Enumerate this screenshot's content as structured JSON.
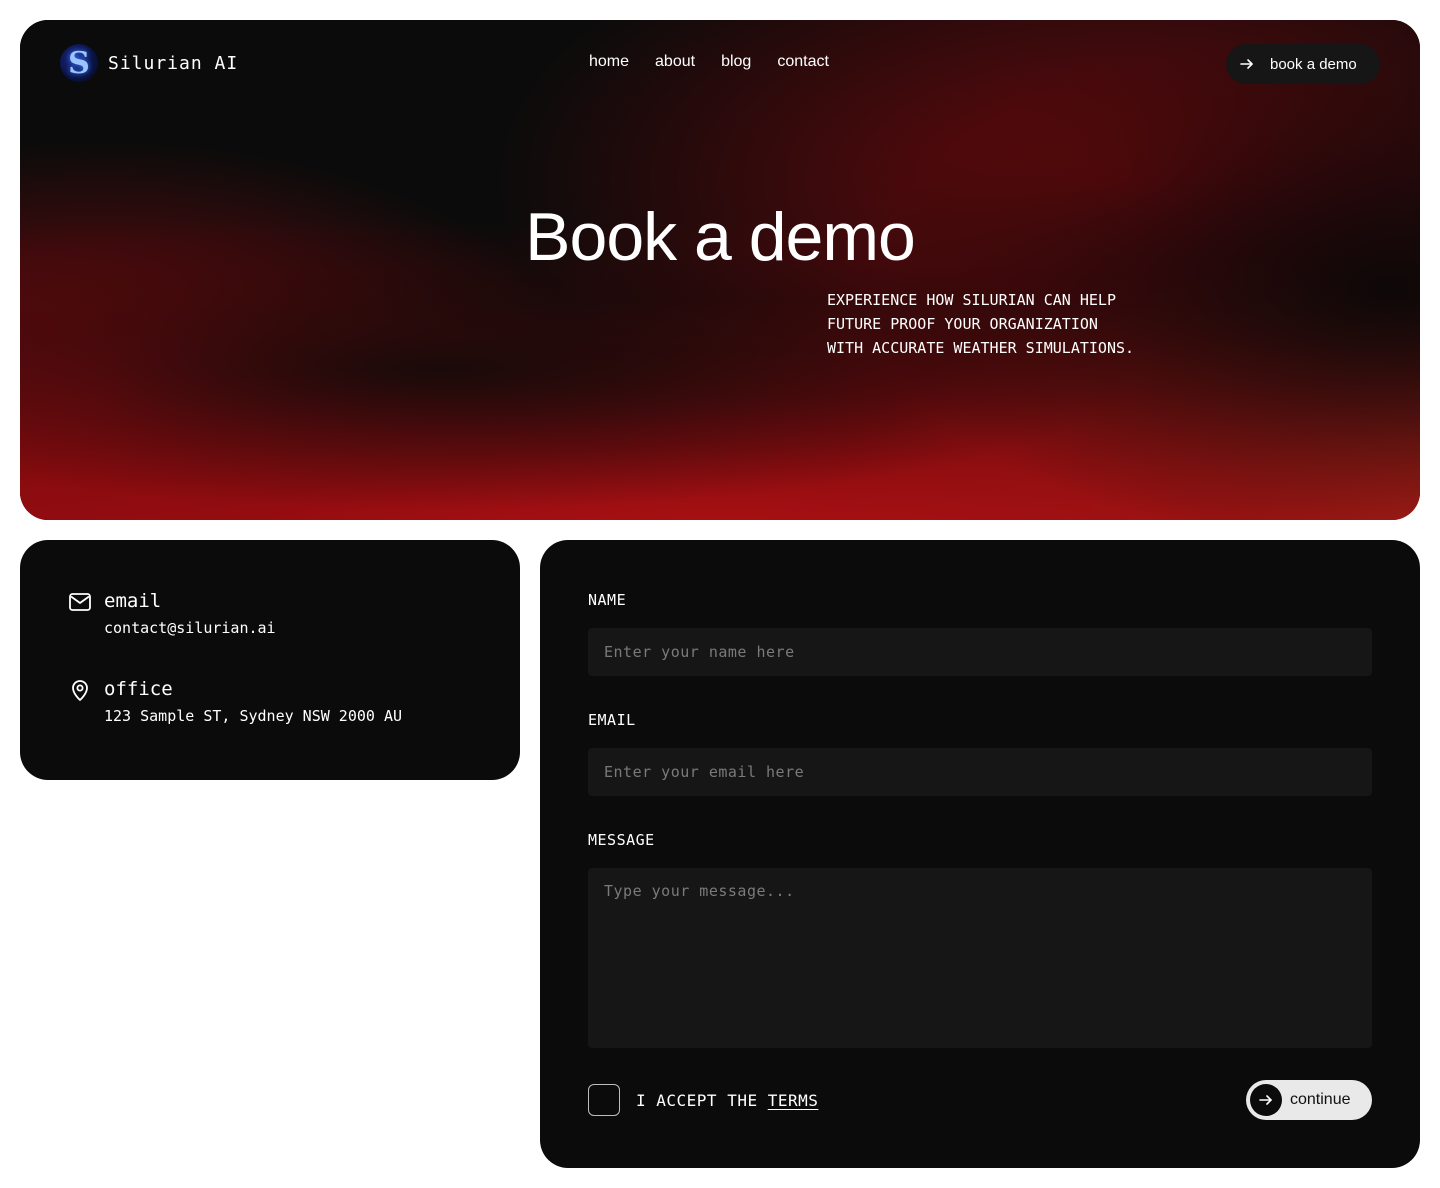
{
  "brand": {
    "name": "Silurian AI",
    "logo_letter": "S"
  },
  "nav": {
    "items": [
      {
        "label": "home"
      },
      {
        "label": "about"
      },
      {
        "label": "blog"
      },
      {
        "label": "contact"
      }
    ],
    "cta_label": "book a demo"
  },
  "hero": {
    "title": "Book a demo",
    "subtitle_lines": [
      "EXPERIENCE HOW SILURIAN CAN HELP",
      "FUTURE PROOF YOUR ORGANIZATION",
      "WITH ACCURATE WEATHER SIMULATIONS."
    ]
  },
  "contact": {
    "email": {
      "title": "email",
      "value": "contact@silurian.ai",
      "icon": "mail-icon"
    },
    "office": {
      "title": "office",
      "value": "123 Sample ST, Sydney NSW 2000 AU",
      "icon": "map-pin-icon"
    }
  },
  "form": {
    "name": {
      "label": "NAME",
      "placeholder": "Enter your name here",
      "value": ""
    },
    "email": {
      "label": "EMAIL",
      "placeholder": "Enter your email here",
      "value": ""
    },
    "message": {
      "label": "MESSAGE",
      "placeholder": "Type your message...",
      "value": ""
    },
    "terms": {
      "prefix": "I ACCEPT THE ",
      "link": "TERMS",
      "checked": false
    },
    "submit_label": "continue"
  },
  "colors": {
    "background": "#0b0b0b",
    "accent_red": "#af1214",
    "input_bg": "#161616",
    "button_light": "#e9e9e9"
  }
}
